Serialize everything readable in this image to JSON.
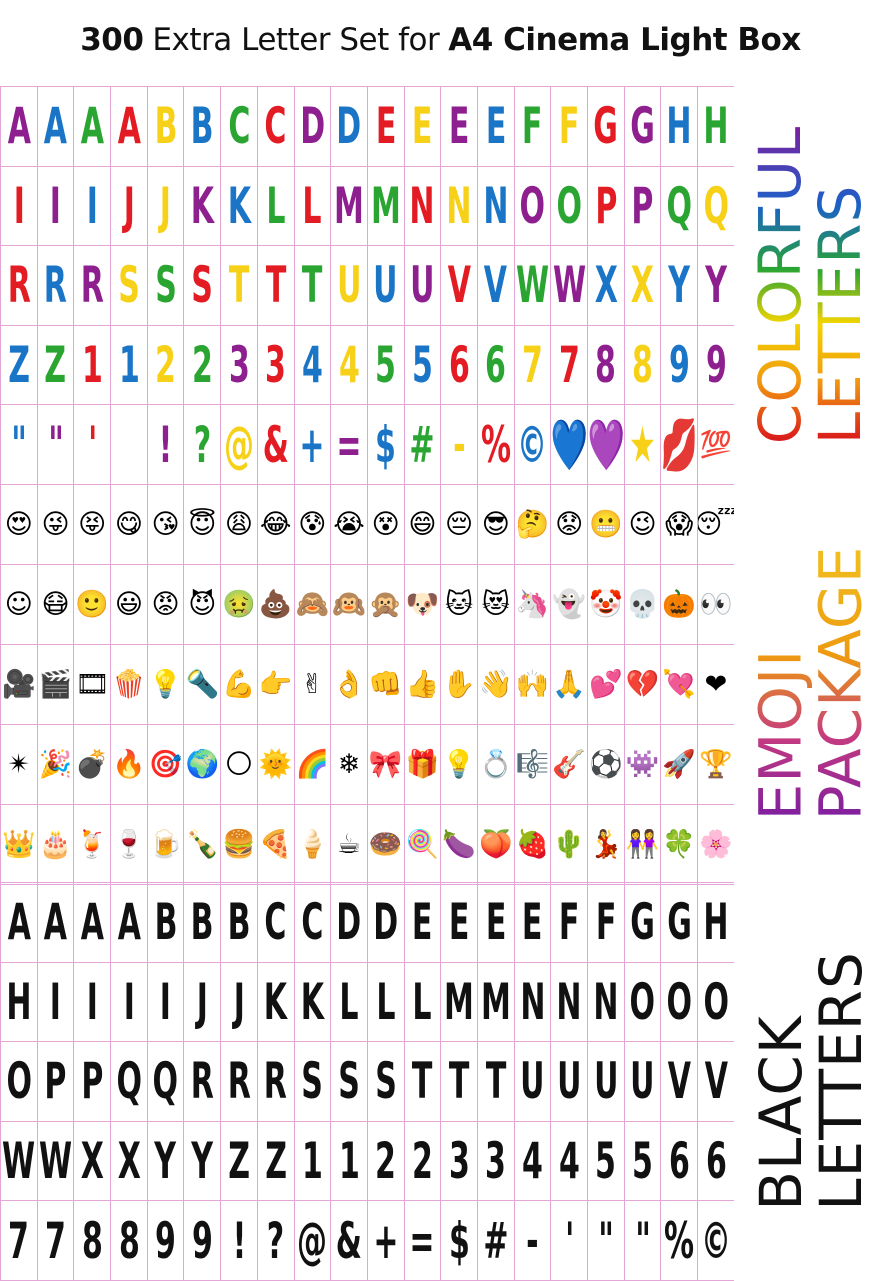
{
  "title": {
    "count": "300",
    "middle": "Extra Letter Set for",
    "product": "A4 Cinema Light Box"
  },
  "colors": {
    "red": "#e31b23",
    "orange": "#f39200",
    "yellow": "#f7d117",
    "green": "#2aa532",
    "blue": "#1b75c7",
    "purple": "#8e1f8f",
    "grid_line": "#e4a6d6"
  },
  "colorful_letters": [
    {
      "ch": "A",
      "c": "#8e1f8f"
    },
    {
      "ch": "A",
      "c": "#1b75c7"
    },
    {
      "ch": "A",
      "c": "#2aa532"
    },
    {
      "ch": "A",
      "c": "#e31b23"
    },
    {
      "ch": "B",
      "c": "#f7d117"
    },
    {
      "ch": "B",
      "c": "#1b75c7"
    },
    {
      "ch": "C",
      "c": "#2aa532"
    },
    {
      "ch": "C",
      "c": "#e31b23"
    },
    {
      "ch": "D",
      "c": "#8e1f8f"
    },
    {
      "ch": "D",
      "c": "#1b75c7"
    },
    {
      "ch": "E",
      "c": "#e31b23"
    },
    {
      "ch": "E",
      "c": "#f7d117"
    },
    {
      "ch": "E",
      "c": "#8e1f8f"
    },
    {
      "ch": "E",
      "c": "#1b75c7"
    },
    {
      "ch": "F",
      "c": "#2aa532"
    },
    {
      "ch": "F",
      "c": "#f7d117"
    },
    {
      "ch": "G",
      "c": "#e31b23"
    },
    {
      "ch": "G",
      "c": "#8e1f8f"
    },
    {
      "ch": "H",
      "c": "#1b75c7"
    },
    {
      "ch": "H",
      "c": "#2aa532"
    },
    {
      "ch": "I",
      "c": "#e31b23"
    },
    {
      "ch": "I",
      "c": "#8e1f8f"
    },
    {
      "ch": "I",
      "c": "#1b75c7"
    },
    {
      "ch": "J",
      "c": "#e31b23"
    },
    {
      "ch": "J",
      "c": "#f7d117"
    },
    {
      "ch": "K",
      "c": "#8e1f8f"
    },
    {
      "ch": "K",
      "c": "#1b75c7"
    },
    {
      "ch": "L",
      "c": "#2aa532"
    },
    {
      "ch": "L",
      "c": "#e31b23"
    },
    {
      "ch": "M",
      "c": "#8e1f8f"
    },
    {
      "ch": "M",
      "c": "#2aa532"
    },
    {
      "ch": "N",
      "c": "#e31b23"
    },
    {
      "ch": "N",
      "c": "#f7d117"
    },
    {
      "ch": "N",
      "c": "#1b75c7"
    },
    {
      "ch": "O",
      "c": "#8e1f8f"
    },
    {
      "ch": "O",
      "c": "#2aa532"
    },
    {
      "ch": "P",
      "c": "#e31b23"
    },
    {
      "ch": "P",
      "c": "#8e1f8f"
    },
    {
      "ch": "Q",
      "c": "#2aa532"
    },
    {
      "ch": "Q",
      "c": "#f7d117"
    },
    {
      "ch": "R",
      "c": "#e31b23"
    },
    {
      "ch": "R",
      "c": "#1b75c7"
    },
    {
      "ch": "R",
      "c": "#8e1f8f"
    },
    {
      "ch": "S",
      "c": "#f7d117"
    },
    {
      "ch": "S",
      "c": "#2aa532"
    },
    {
      "ch": "S",
      "c": "#e31b23"
    },
    {
      "ch": "T",
      "c": "#f7d117"
    },
    {
      "ch": "T",
      "c": "#e31b23"
    },
    {
      "ch": "T",
      "c": "#2aa532"
    },
    {
      "ch": "U",
      "c": "#f7d117"
    },
    {
      "ch": "U",
      "c": "#1b75c7"
    },
    {
      "ch": "U",
      "c": "#8e1f8f"
    },
    {
      "ch": "V",
      "c": "#e31b23"
    },
    {
      "ch": "V",
      "c": "#1b75c7"
    },
    {
      "ch": "W",
      "c": "#2aa532"
    },
    {
      "ch": "W",
      "c": "#8e1f8f"
    },
    {
      "ch": "X",
      "c": "#1b75c7"
    },
    {
      "ch": "X",
      "c": "#f7d117"
    },
    {
      "ch": "Y",
      "c": "#1b75c7"
    },
    {
      "ch": "Y",
      "c": "#8e1f8f"
    },
    {
      "ch": "Z",
      "c": "#1b75c7"
    },
    {
      "ch": "Z",
      "c": "#2aa532"
    },
    {
      "ch": "1",
      "c": "#e31b23"
    },
    {
      "ch": "1",
      "c": "#1b75c7"
    },
    {
      "ch": "2",
      "c": "#f7d117"
    },
    {
      "ch": "2",
      "c": "#2aa532"
    },
    {
      "ch": "3",
      "c": "#8e1f8f"
    },
    {
      "ch": "3",
      "c": "#e31b23"
    },
    {
      "ch": "4",
      "c": "#1b75c7"
    },
    {
      "ch": "4",
      "c": "#f7d117"
    },
    {
      "ch": "5",
      "c": "#2aa532"
    },
    {
      "ch": "5",
      "c": "#1b75c7"
    },
    {
      "ch": "6",
      "c": "#e31b23"
    },
    {
      "ch": "6",
      "c": "#2aa532"
    },
    {
      "ch": "7",
      "c": "#f7d117"
    },
    {
      "ch": "7",
      "c": "#e31b23"
    },
    {
      "ch": "8",
      "c": "#8e1f8f"
    },
    {
      "ch": "8",
      "c": "#f7d117"
    },
    {
      "ch": "9",
      "c": "#1b75c7"
    },
    {
      "ch": "9",
      "c": "#8e1f8f"
    },
    {
      "ch": "\"",
      "c": "#1b75c7"
    },
    {
      "ch": "\"",
      "c": "#8e1f8f"
    },
    {
      "ch": "'",
      "c": "#e31b23"
    },
    {
      "ch": "",
      "c": "#000000"
    },
    {
      "ch": "!",
      "c": "#8e1f8f"
    },
    {
      "ch": "?",
      "c": "#2aa532"
    },
    {
      "ch": "@",
      "c": "#f7d117"
    },
    {
      "ch": "&",
      "c": "#e31b23"
    },
    {
      "ch": "+",
      "c": "#1b75c7"
    },
    {
      "ch": "=",
      "c": "#8e1f8f"
    },
    {
      "ch": "$",
      "c": "#1b75c7"
    },
    {
      "ch": "#",
      "c": "#2aa532"
    },
    {
      "ch": "-",
      "c": "#f7d117"
    },
    {
      "ch": "%",
      "c": "#e31b23"
    },
    {
      "ch": "©",
      "c": "#1b75c7"
    },
    {
      "ch": "💙",
      "c": "#1b75c7"
    },
    {
      "ch": "💜",
      "c": "#8e1f8f"
    },
    {
      "ch": "★",
      "c": "#f7d117"
    },
    {
      "ch": "★",
      "c": "#f7d117"
    },
    {
      "ch": "💋",
      "c": "#e31b23"
    }
  ],
  "colorful_extra": "💯",
  "emoji": [
    "😍",
    "😜",
    "😝",
    "😋",
    "😘",
    "😇",
    "😩",
    "😂",
    "😰",
    "😭",
    "😵",
    "😄",
    "😔",
    "😎",
    "🤔",
    "😟",
    "😬",
    "😉",
    "😱",
    "😴",
    "☺",
    "😷",
    "🙂",
    "😃",
    "😡",
    "😈",
    "🤢",
    "💩",
    "🙈",
    "🙉",
    "🙊",
    "🐶",
    "🐱",
    "😻",
    "🦄",
    "👻",
    "🤡",
    "💀",
    "🎃",
    "👀",
    "🎥",
    "🎬",
    "🎞",
    "🍿",
    "💡",
    "🔦",
    "💪",
    "👉",
    "✌",
    "👌",
    "👊",
    "👍",
    "✋",
    "👋",
    "🙌",
    "🙏",
    "💕",
    "💔",
    "💘",
    "❤",
    "✴",
    "🎉",
    "💣",
    "🔥",
    "🎯",
    "🌍",
    "🌕",
    "🌞",
    "🌈",
    "❄",
    "🎀",
    "🎁",
    "💡",
    "💍",
    "🎼",
    "🎸",
    "⚽",
    "👾",
    "🚀",
    "🏆",
    "👑",
    "🎂",
    "🍹",
    "🍷",
    "🍺",
    "🍾",
    "🍔",
    "🍕",
    "🍦",
    "☕",
    "🍩",
    "🍭",
    "🍆",
    "🍑",
    "🍓",
    "🌵",
    "💃",
    "👭",
    "🍀",
    "🌸"
  ],
  "black_letters": [
    "A",
    "A",
    "A",
    "A",
    "B",
    "B",
    "B",
    "C",
    "C",
    "D",
    "D",
    "E",
    "E",
    "E",
    "E",
    "F",
    "F",
    "G",
    "G",
    "H",
    "H",
    "I",
    "I",
    "I",
    "I",
    "J",
    "J",
    "K",
    "K",
    "L",
    "L",
    "L",
    "M",
    "M",
    "N",
    "N",
    "N",
    "O",
    "O",
    "O",
    "O",
    "P",
    "P",
    "Q",
    "Q",
    "R",
    "R",
    "R",
    "S",
    "S",
    "S",
    "T",
    "T",
    "T",
    "U",
    "U",
    "U",
    "U",
    "V",
    "V",
    "W",
    "W",
    "X",
    "X",
    "Y",
    "Y",
    "Z",
    "Z",
    "1",
    "1",
    "2",
    "2",
    "3",
    "3",
    "4",
    "4",
    "5",
    "5",
    "6",
    "6",
    "7",
    "7",
    "8",
    "8",
    "9",
    "9",
    "!",
    "?",
    "@",
    "&",
    "+",
    "=",
    "$",
    "#",
    "-",
    "'",
    "\"",
    "\"",
    "%",
    "©"
  ],
  "side_labels": {
    "colorful": [
      "COLORFUL",
      "LETTERS"
    ],
    "emoji": [
      "EMOJI",
      "PACKAGE"
    ],
    "black": [
      "BLACK",
      "LETTERS"
    ]
  }
}
